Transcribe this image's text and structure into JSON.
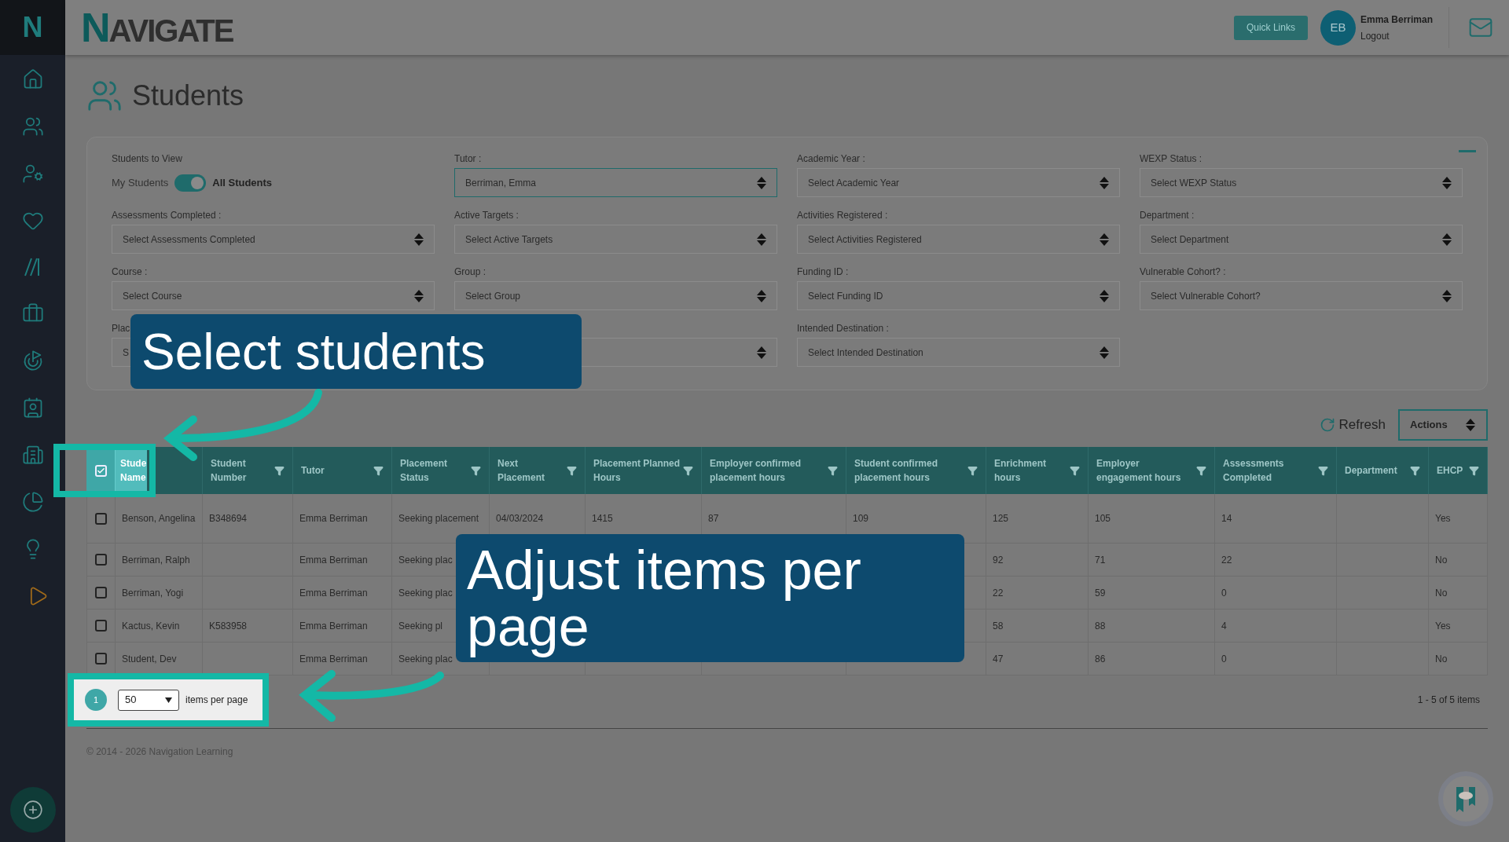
{
  "sidebar": {
    "logo": "N",
    "items": [
      {
        "kind": "home"
      },
      {
        "kind": "users"
      },
      {
        "kind": "user-tag"
      },
      {
        "kind": "heart"
      },
      {
        "kind": "slashes"
      },
      {
        "kind": "briefcase"
      },
      {
        "kind": "target"
      },
      {
        "kind": "contact"
      },
      {
        "kind": "building-user"
      },
      {
        "kind": "pie"
      },
      {
        "kind": "bulb"
      },
      {
        "kind": "play"
      }
    ]
  },
  "header": {
    "logo": "NAVIGATE",
    "quick_links": "Quick Links",
    "avatar": "EB",
    "user_name": "Emma Berriman",
    "logout": "Logout"
  },
  "page_title": "Students",
  "filters": [
    {
      "kind": "toggle",
      "label": "Students to View",
      "off_label": "My Students",
      "on_label": "All Students",
      "on": true
    },
    {
      "kind": "select",
      "label": "Tutor :",
      "value": "Berriman, Emma"
    },
    {
      "kind": "select",
      "label": "Academic Year :",
      "placeholder": "Select Academic Year"
    },
    {
      "kind": "select",
      "label": "WEXP Status :",
      "placeholder": "Select WEXP Status"
    },
    {
      "kind": "select",
      "label": "Assessments Completed :",
      "placeholder": "Select Assessments Completed"
    },
    {
      "kind": "select",
      "label": "Active Targets :",
      "placeholder": "Select Active Targets"
    },
    {
      "kind": "select",
      "label": "Activities Registered :",
      "placeholder": "Select Activities Registered"
    },
    {
      "kind": "select",
      "label": "Department :",
      "placeholder": "Select Department"
    },
    {
      "kind": "select",
      "label": "Course :",
      "placeholder": "Select Course"
    },
    {
      "kind": "select",
      "label": "Group :",
      "placeholder": "Select Group"
    },
    {
      "kind": "select",
      "label": "Funding ID :",
      "placeholder": "Select Funding ID"
    },
    {
      "kind": "select",
      "label": "Vulnerable Cohort? :",
      "placeholder": "Select Vulnerable Cohort?"
    },
    {
      "kind": "partial",
      "label": "Plac",
      "placeholder": "S"
    },
    {
      "kind": "select"
    },
    {
      "kind": "select",
      "label": "Intended Destination :",
      "placeholder": "Select Intended Destination"
    }
  ],
  "toolbar": {
    "refresh": "Refresh",
    "actions": "Actions"
  },
  "table": {
    "select_all_checked": true,
    "columns": [
      {
        "label": "Stude Name",
        "filter": false
      },
      {
        "label": "Student Number",
        "filter": true
      },
      {
        "label": "Tutor",
        "filter": true
      },
      {
        "label": "Placement Status",
        "filter": true
      },
      {
        "label": "Next Placement",
        "filter": true
      },
      {
        "label": "Placement Planned Hours",
        "filter": true
      },
      {
        "label": "Employer confirmed placement hours",
        "filter": true
      },
      {
        "label": "Student confirmed placement hours",
        "filter": true
      },
      {
        "label": "Enrichment hours",
        "filter": true
      },
      {
        "label": "Employer engagement hours",
        "filter": true
      },
      {
        "label": "Assessments Completed",
        "filter": true
      },
      {
        "label": "Department",
        "filter": true
      },
      {
        "label": "EHCP",
        "filter": true
      }
    ],
    "rows": [
      {
        "selected": false,
        "cells": [
          "Benson, Angelina",
          "B348694",
          "Emma Berriman",
          "Seeking placement",
          "04/03/2024",
          "1415",
          "87",
          "109",
          "125",
          "105",
          "14",
          "",
          "Yes"
        ]
      },
      {
        "selected": false,
        "cells": [
          "Berriman, Ralph",
          "",
          "Emma Berriman",
          "Seeking plac",
          "",
          "",
          "",
          "",
          "92",
          "71",
          "22",
          "",
          "No"
        ]
      },
      {
        "selected": false,
        "cells": [
          "Berriman, Yogi",
          "",
          "Emma Berriman",
          "Seeking plac",
          "",
          "",
          "",
          "",
          "22",
          "59",
          "0",
          "",
          "No"
        ]
      },
      {
        "selected": false,
        "cells": [
          "Kactus, Kevin",
          "K583958",
          "Emma Berriman",
          "Seeking pl",
          "",
          "",
          "",
          "",
          "58",
          "88",
          "4",
          "",
          "Yes"
        ]
      },
      {
        "selected": false,
        "cells": [
          "Student, Dev",
          "",
          "Emma Berriman",
          "Seeking plac",
          "",
          "",
          "",
          "",
          "47",
          "86",
          "0",
          "",
          "No"
        ]
      }
    ]
  },
  "pagination": {
    "page": "1",
    "page_size": "50",
    "per_page_label": "items per page",
    "summary": "1 - 5 of 5 items"
  },
  "footer": "© 2014 - 2026 Navigation Learning",
  "callouts": [
    "Select students",
    "Adjust items per page"
  ]
}
